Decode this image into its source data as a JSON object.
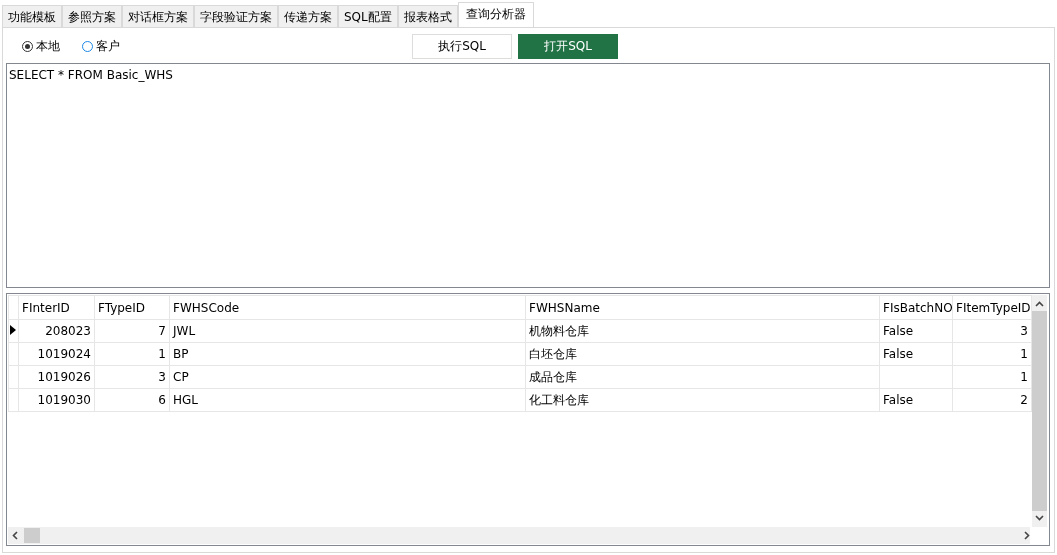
{
  "tabs": [
    {
      "label": "功能模板",
      "selected": false
    },
    {
      "label": "参照方案",
      "selected": false
    },
    {
      "label": "对话框方案",
      "selected": false
    },
    {
      "label": "字段验证方案",
      "selected": false
    },
    {
      "label": "传递方案",
      "selected": false
    },
    {
      "label": "SQL配置",
      "selected": false
    },
    {
      "label": "报表格式",
      "selected": false
    },
    {
      "label": "查询分析器",
      "selected": true
    }
  ],
  "source_options": [
    {
      "label": "本地",
      "selected": true
    },
    {
      "label": "客户",
      "selected": false
    }
  ],
  "buttons": [
    {
      "label": "执行SQL",
      "kind": "default"
    },
    {
      "label": "打开SQL",
      "kind": "primary"
    }
  ],
  "sql_editor": {
    "value": "SELECT * FROM Basic_WHS"
  },
  "table": {
    "columns": [
      {
        "label": "FInterID",
        "kind": "number"
      },
      {
        "label": "FTypeID",
        "kind": "number"
      },
      {
        "label": "FWHSCode",
        "kind": "text"
      },
      {
        "label": "FWHSName",
        "kind": "text"
      },
      {
        "label": "FIsBatchNO",
        "kind": "text"
      },
      {
        "label": "FItemTypeID",
        "kind": "number"
      }
    ],
    "rows": [
      {
        "selected": true,
        "cells": [
          "208023",
          "7",
          "JWL",
          "机物料仓库",
          "False",
          "3"
        ]
      },
      {
        "selected": false,
        "cells": [
          "1019024",
          "1",
          "BP",
          "白坯仓库",
          "False",
          "1"
        ]
      },
      {
        "selected": false,
        "cells": [
          "1019026",
          "3",
          "CP",
          "成品仓库",
          "",
          "1"
        ]
      },
      {
        "selected": false,
        "cells": [
          "1019030",
          "6",
          "HGL",
          "化工料仓库",
          "False",
          "2"
        ]
      }
    ]
  }
}
